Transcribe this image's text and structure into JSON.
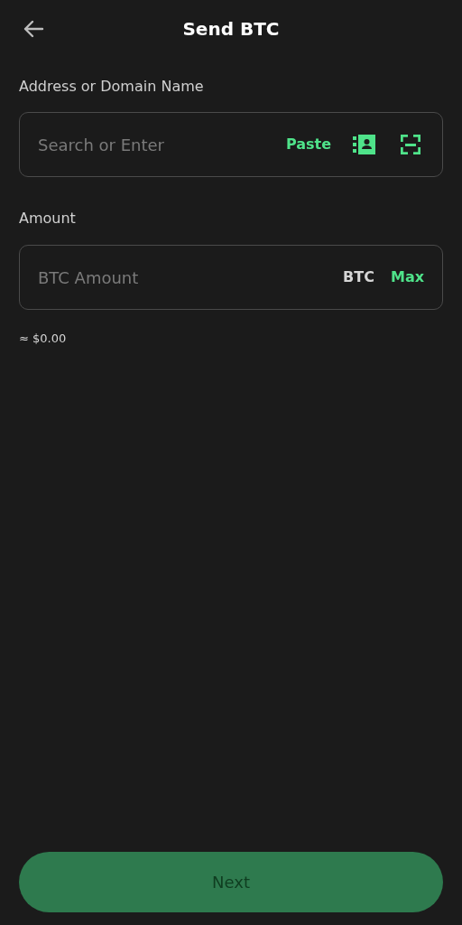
{
  "header": {
    "title": "Send BTC"
  },
  "address": {
    "label": "Address or Domain Name",
    "placeholder": "Search or Enter",
    "paste": "Paste"
  },
  "amount": {
    "label": "Amount",
    "placeholder": "BTC Amount",
    "unit": "BTC",
    "max": "Max",
    "fiat": "≈ $0.00"
  },
  "next_button": {
    "label": "Next",
    "disabled": true
  }
}
